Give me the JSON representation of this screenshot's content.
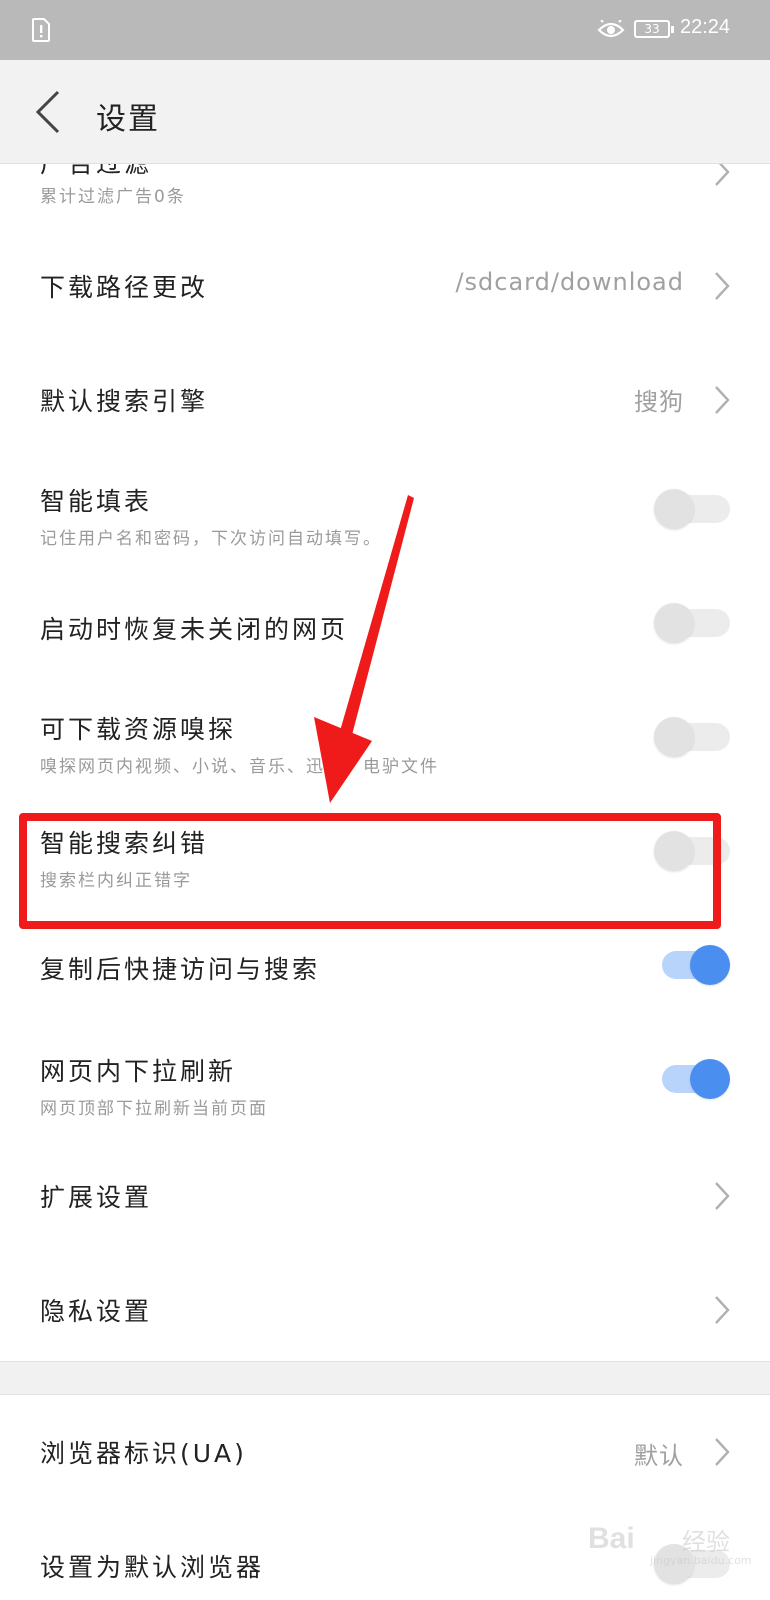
{
  "status_bar": {
    "battery_level": "33",
    "time": "22:24"
  },
  "header": {
    "title": "设置"
  },
  "settings": {
    "ad_filter": {
      "label": "广告过滤",
      "sub": "累计过滤广告0条"
    },
    "download_path": {
      "label": "下载路径更改",
      "value": "/sdcard/download"
    },
    "search_engine": {
      "label": "默认搜索引擎",
      "value": "搜狗"
    },
    "smart_fill": {
      "label": "智能填表",
      "sub": "记住用户名和密码，下次访问自动填写。",
      "on": false
    },
    "restore_pages": {
      "label": "启动时恢复未关闭的网页",
      "on": false
    },
    "resource_sniff": {
      "label": "可下载资源嗅探",
      "sub": "嗅探网页内视频、小说、音乐、迅雷、电驴文件",
      "on": false
    },
    "search_correct": {
      "label": "智能搜索纠错",
      "sub": "搜索栏内纠正错字",
      "on": false
    },
    "copy_search": {
      "label": "复制后快捷访问与搜索",
      "on": true
    },
    "pull_refresh": {
      "label": "网页内下拉刷新",
      "sub": "网页顶部下拉刷新当前页面",
      "on": true
    },
    "extension": {
      "label": "扩展设置"
    },
    "privacy": {
      "label": "隐私设置"
    },
    "user_agent": {
      "label": "浏览器标识(UA)",
      "value": "默认"
    },
    "default_browser": {
      "label": "设置为默认浏览器",
      "on": false
    }
  },
  "colors": {
    "highlight": "#ef1b1b",
    "toggle_on": "#4a8ff0",
    "status_bar": "#b9b9b9"
  },
  "watermark": {
    "brand": "Bai",
    "jingyan": "经验",
    "url": "jingyan.baidu.com"
  }
}
